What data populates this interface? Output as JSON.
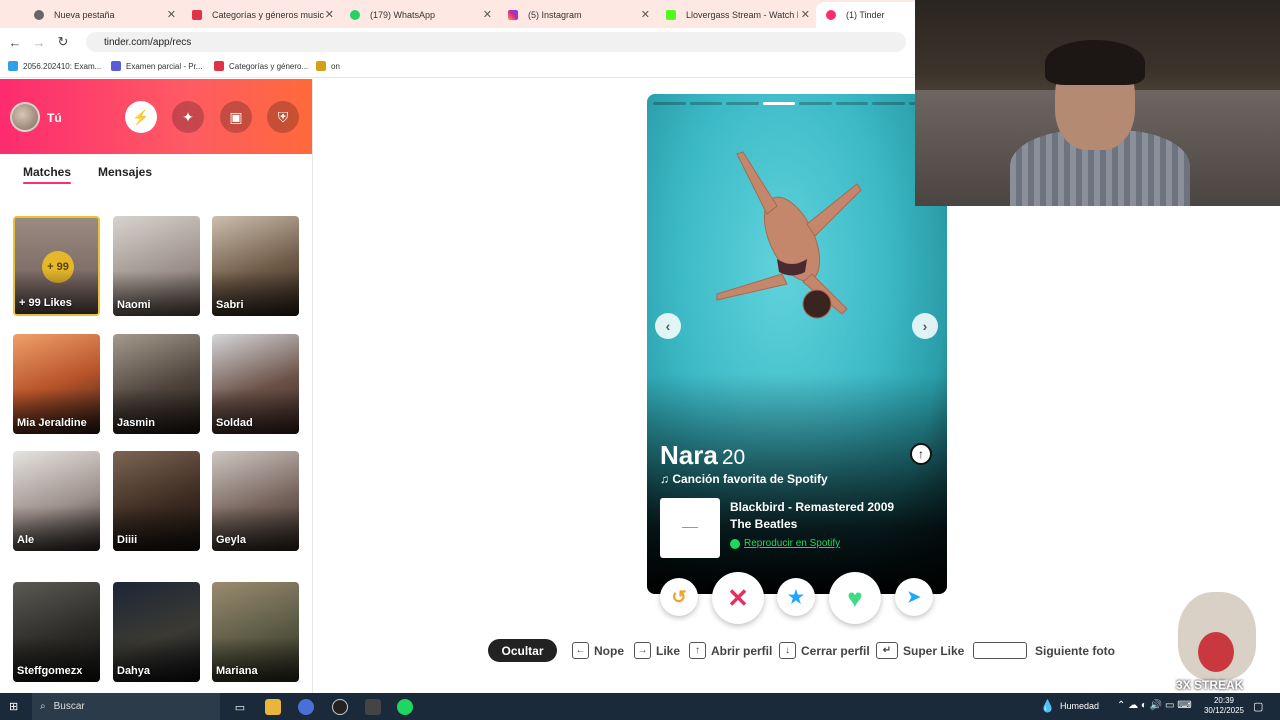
{
  "browser": {
    "tabs": [
      {
        "label": "Nueva pestaña",
        "color": "#555555",
        "icon": "globe-icon"
      },
      {
        "label": "Categorías y géneros musicales",
        "color": "#e0334a",
        "icon": "music-icon"
      },
      {
        "label": "(179) WhatsApp",
        "color": "#25d366",
        "icon": "whatsapp-icon"
      },
      {
        "label": "(5) Instagram",
        "color": "#d6249f",
        "icon": "instagram-icon"
      },
      {
        "label": "Llovergass Stream - Watch Live",
        "color": "#53fc18",
        "icon": "kick-icon"
      },
      {
        "label": "(1) Tinder",
        "color": "#fd2b6f",
        "icon": "tinder-icon"
      }
    ],
    "url": "tinder.com/app/recs",
    "bookmarks": [
      {
        "label": "2056.202410: Exam...",
        "color": "#2ea0e6"
      },
      {
        "label": "Examen parcial - Pr...",
        "color": "#5b5bd6"
      },
      {
        "label": "Categorías y género...",
        "color": "#e0334a"
      },
      {
        "label": "on",
        "color": "#d4a017"
      }
    ]
  },
  "sidebar": {
    "user_label": "Tú",
    "tabs": [
      "Matches",
      "Mensajes"
    ],
    "likes_badge": "+ 99",
    "likes_label": "+ 99 Likes",
    "matches": [
      {
        "name": "Naomi"
      },
      {
        "name": "Sabri"
      },
      {
        "name": "Mia Jeraldine"
      },
      {
        "name": "Jasmin"
      },
      {
        "name": "Soldad"
      },
      {
        "name": "Ale"
      },
      {
        "name": "Diiii"
      },
      {
        "name": "Geyla"
      },
      {
        "name": "Steffgomezx"
      },
      {
        "name": "Dahya"
      },
      {
        "name": "Mariana"
      }
    ]
  },
  "profile": {
    "name": "Nara",
    "age": "20",
    "spotify_heading": "Canción favorita de Spotify",
    "song_title": "Blackbird - Remastered 2009",
    "song_artist": "The Beatles",
    "play_label": "Reproducir en Spotify",
    "photo_count": 8,
    "current_photo": 4
  },
  "hints": {
    "ocultar": "Ocultar",
    "nope": "Nope",
    "like": "Like",
    "abrir": "Abrir perfil",
    "cerrar": "Cerrar perfil",
    "super": "Super Like",
    "siguiente": "Siguiente foto"
  },
  "overlay": {
    "meme_text": "3X STREAK"
  },
  "taskbar": {
    "search": "Buscar",
    "weather": "Humedad",
    "time": "20:39",
    "date": "30/12/2025"
  },
  "colors": {
    "brand": "#fd2b6f",
    "nope": "#e3305f",
    "superlike": "#1ea7fd",
    "like": "#3ddc84",
    "boost": "#1ea7fd",
    "rewind": "#f1a129"
  }
}
